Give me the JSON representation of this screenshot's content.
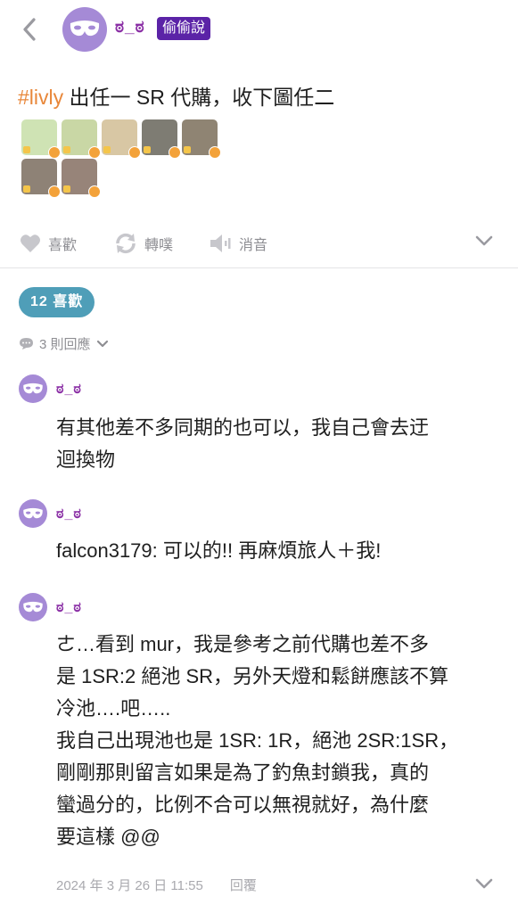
{
  "header": {
    "poster_name": "ಠ_ಠ",
    "anon_badge": "偷偷說"
  },
  "post": {
    "hashtag": "#livly",
    "text": " 出任一 SR 代購，收下圖任二",
    "stickers": [
      {
        "name": "sticker-1",
        "color": "#cfe3b4"
      },
      {
        "name": "sticker-2",
        "color": "#c9d7a5"
      },
      {
        "name": "sticker-3",
        "color": "#d8c7a4"
      },
      {
        "name": "sticker-4",
        "color": "#7e7c73"
      },
      {
        "name": "sticker-5",
        "color": "#8f8473"
      },
      {
        "name": "sticker-6",
        "color": "#8e8276"
      },
      {
        "name": "sticker-7",
        "color": "#978479"
      }
    ]
  },
  "actions": {
    "like_label": "喜歡",
    "repost_label": "轉噗",
    "mute_label": "消音"
  },
  "likes_pill": "12 喜歡",
  "replies_toggle": "3 則回應",
  "comments": [
    {
      "name": "ಠ_ಠ",
      "lines": [
        "有其他差不多同期的也可以，我自己會去迂",
        "迴換物"
      ]
    },
    {
      "name": "ಠ_ಠ",
      "lines": [
        "falcon3179: 可以的!! 再麻煩旅人＋我!"
      ]
    },
    {
      "name": "ಠ_ಠ",
      "lines": [
        "ㄜ…看到 mur，我是參考之前代購也差不多",
        "是 1SR:2 絕池 SR，另外天燈和鬆餅應該不算",
        "冷池….吧…..",
        "我自己出現池也是 1SR: 1R，絕池 2SR:1SR，",
        "剛剛那則留言如果是為了釣魚封鎖我，真的",
        "蠻過分的，比例不合可以無視就好，為什麼",
        "要這樣 @@"
      ]
    }
  ],
  "footer": {
    "timestamp": "2024 年 3 月 26 日 11:55",
    "reply_label": "回覆"
  }
}
